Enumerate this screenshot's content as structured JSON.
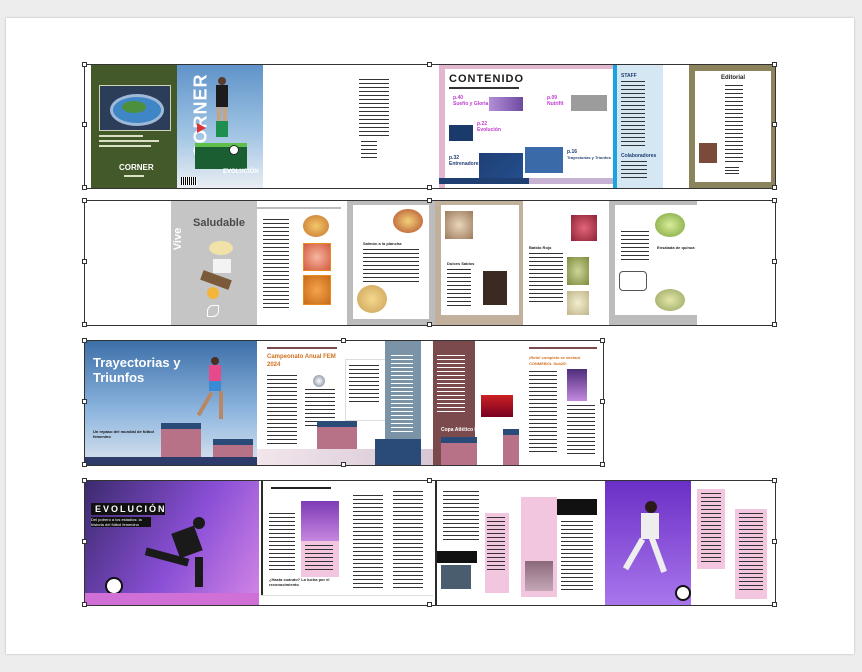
{
  "colors": {
    "green_cover": "#44592a",
    "olive": "#8b835c",
    "navy": "#1f3f73",
    "pink": "#e8bcd4",
    "purple": "#9a55e6",
    "maroon": "#7b4a4c",
    "gray": "#bcbcbc",
    "tan": "#c1b09c",
    "orange": "#e88a1e",
    "blue_light": "#d5e7f2",
    "cyan": "#1aa3e0",
    "red_accent": "#c0392b",
    "steel": "#7a93a6"
  },
  "spread1": {
    "back_cover_title": "CORNER",
    "front_cover_title": "CORNER",
    "evolution_tag": "EVOLUCIÓN",
    "contents_title": "CONTENIDO",
    "items": [
      {
        "page": "p.40",
        "label": "Sueño y Gloria"
      },
      {
        "page": "p.09",
        "label": "Nutrifit"
      },
      {
        "page": "p.22",
        "label": "Evolución"
      },
      {
        "page": "p.32",
        "label": "Entrenadores de élite"
      },
      {
        "page": "p.16",
        "label": "Trayectorias y Triunfos"
      }
    ],
    "staff_title": "STAFF",
    "contributors_title": "Colaboradores",
    "editorial_title": "Editorial"
  },
  "spread2": {
    "title_vive": "Vive",
    "title_saludable": "Saludable",
    "recipe_heading": "Dulces Sabios",
    "recipe_labels": [
      "Salmón a la plancha",
      "Batido Rojo",
      "Ensalada de quinoa"
    ]
  },
  "spread3": {
    "title": "Trayectorias y Triunfos",
    "subtitle": "Un repaso del mundial de fútbol femenino",
    "campeonato_title": "Campeonato Anual FEM 2024",
    "copa_title": "Copa Atlético Femenino",
    "side_title": "¡Reto! completo se declaró CONMEBOL Sub20!"
  },
  "spread4": {
    "title": "EVOLUCIÓN",
    "subtitle": "Del potrero a los estadios: la historia del fútbol femenino",
    "quote": "¿Hasta cuándo? La lucha por el reconocimiento"
  }
}
